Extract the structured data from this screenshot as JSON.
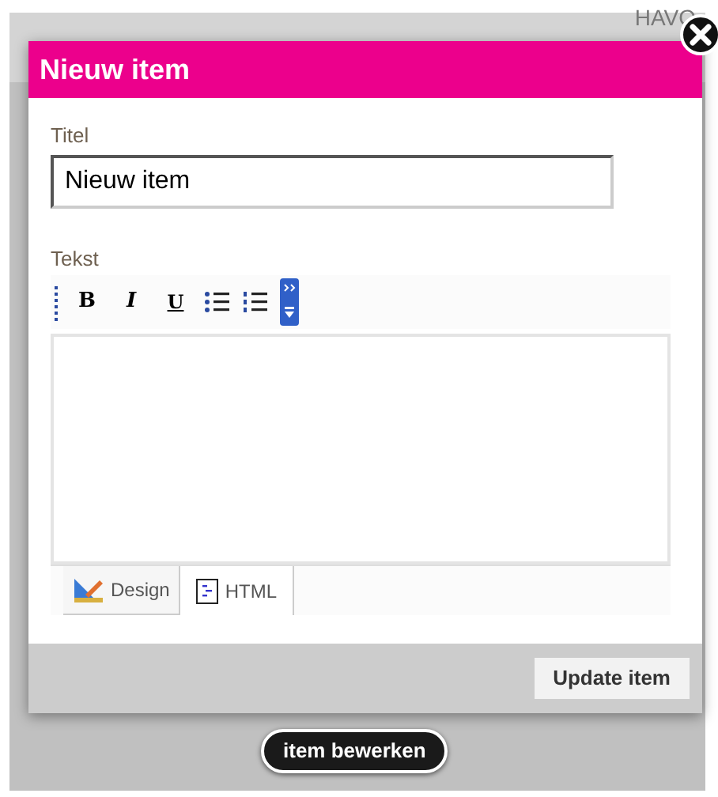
{
  "background": {
    "text": "HAVO"
  },
  "dialog": {
    "title": "Nieuw item",
    "fields": [
      {
        "label": "Titel",
        "value": "Nieuw item"
      }
    ],
    "editor": {
      "label": "Tekst",
      "toolbar": [
        {
          "kind": "bold",
          "label": "B"
        },
        {
          "kind": "italic",
          "label": "I"
        },
        {
          "kind": "underline",
          "label": "U"
        },
        {
          "kind": "bullets"
        },
        {
          "kind": "numbers"
        },
        {
          "kind": "more"
        }
      ],
      "tabs": [
        {
          "label": "Design",
          "kind": "design",
          "selected": true
        },
        {
          "label": "HTML",
          "kind": "html",
          "selected": false
        }
      ]
    },
    "button": "Update item"
  },
  "pill": "item bewerken"
}
